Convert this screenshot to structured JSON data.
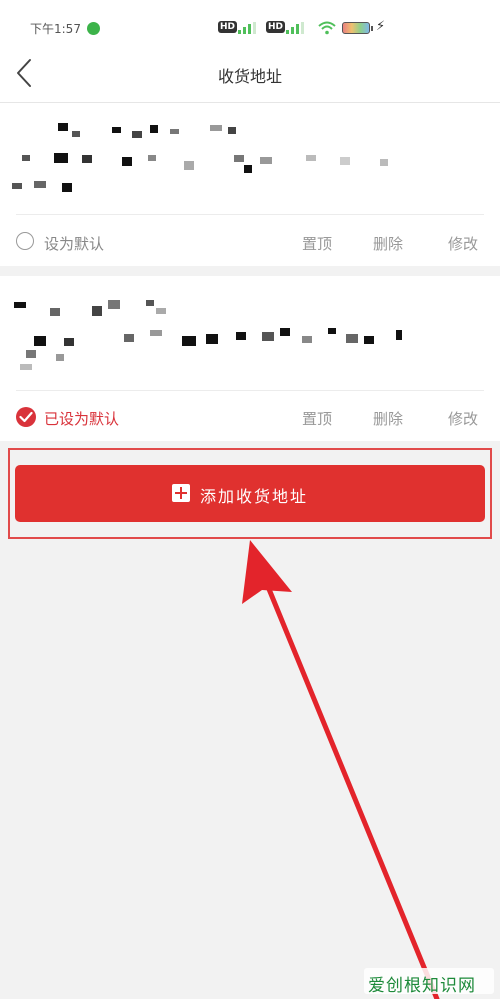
{
  "status_bar": {
    "time": "下午1:57",
    "network_badge_1": "HD",
    "network_badge_2": "HD"
  },
  "nav": {
    "title": "收货地址"
  },
  "addresses": [
    {
      "default_label": "设为默认",
      "is_default": false,
      "actions": {
        "pin": "置顶",
        "delete": "删除",
        "edit": "修改"
      }
    },
    {
      "default_label": "已设为默认",
      "is_default": true,
      "actions": {
        "pin": "置顶",
        "delete": "删除",
        "edit": "修改"
      }
    }
  ],
  "add_button": {
    "label": "添加收货地址"
  },
  "watermark": {
    "text": "爱创根知识网"
  },
  "colors": {
    "accent": "#e0312f",
    "default_active": "#d9333b",
    "arrow": "#e3242b",
    "status_wechat": "#3cb34a"
  },
  "icons": [
    "back-chevron-icon",
    "radio-unchecked-icon",
    "radio-checked-icon",
    "plus-icon",
    "wifi-icon",
    "battery-icon",
    "charging-icon",
    "signal-icon",
    "wechat-icon"
  ]
}
